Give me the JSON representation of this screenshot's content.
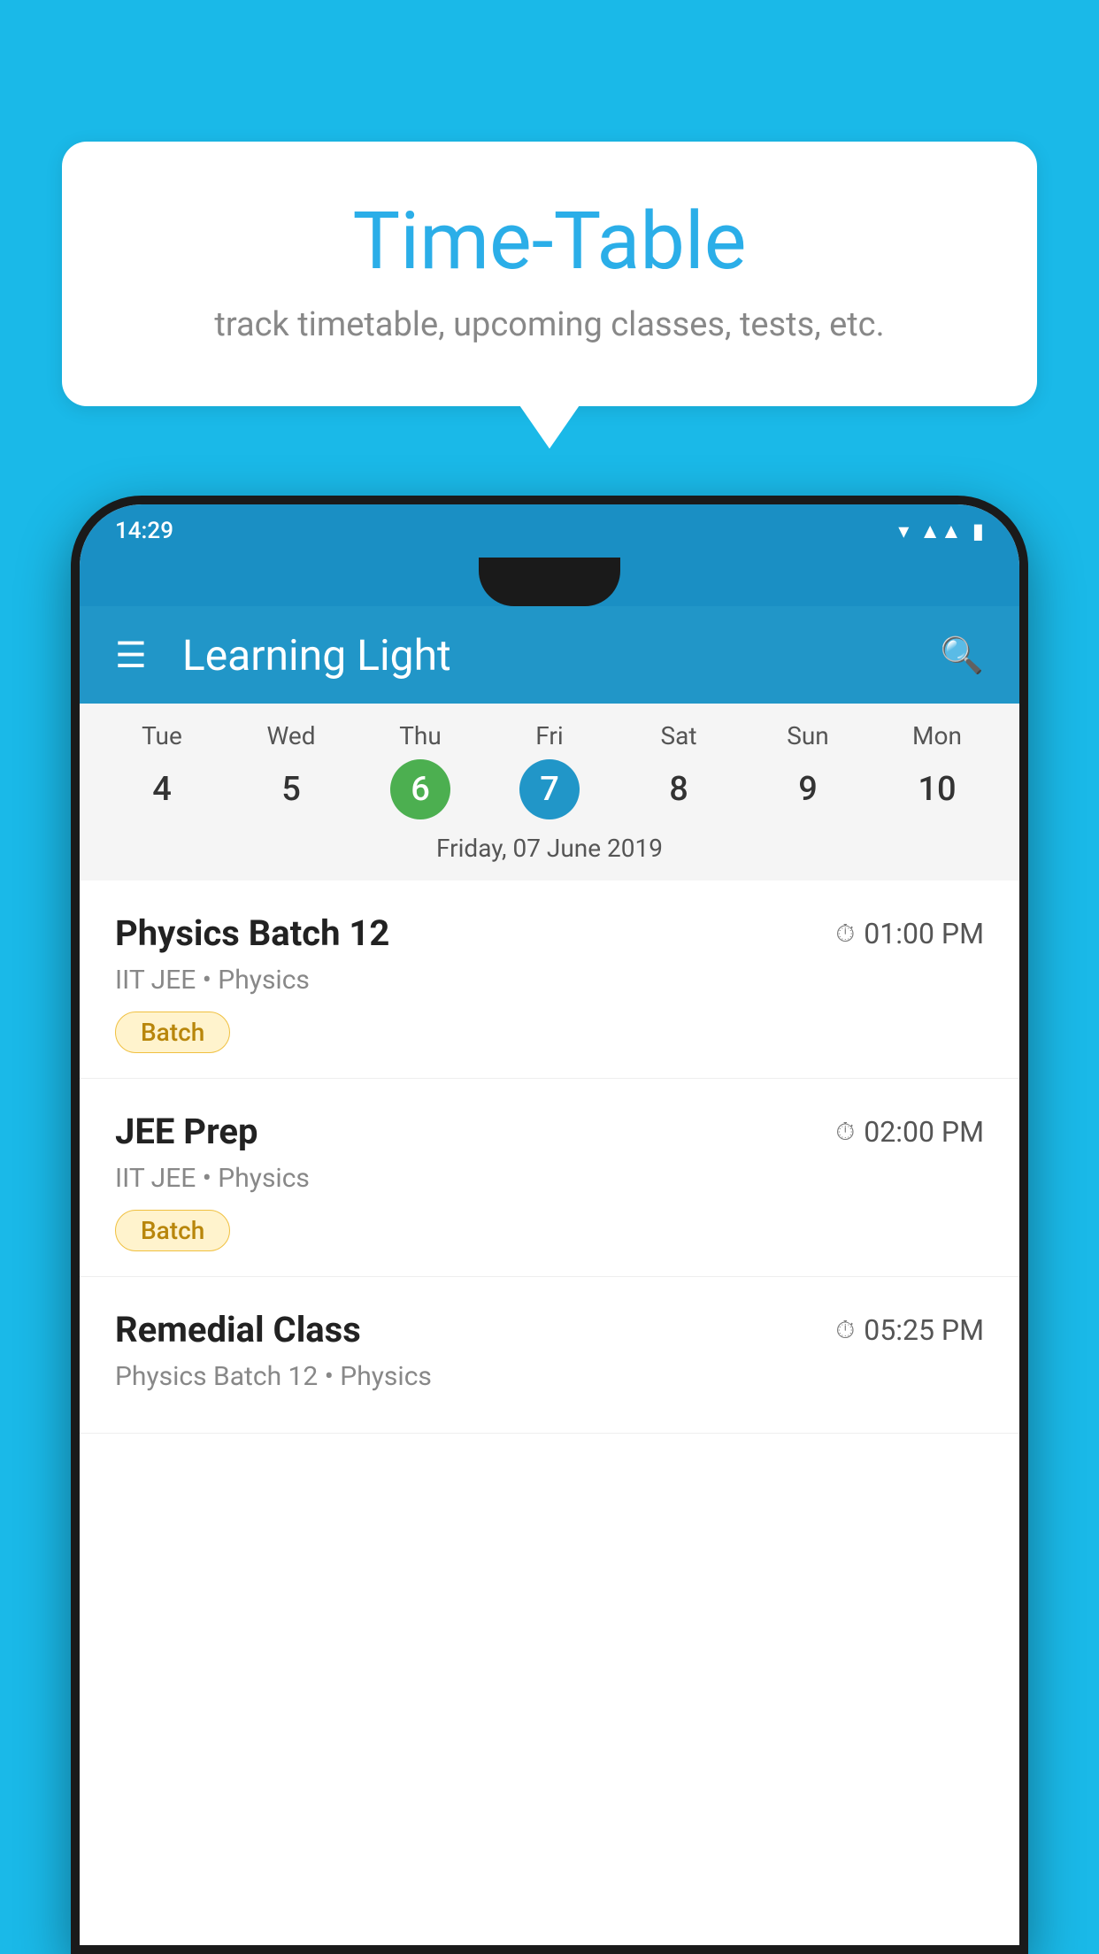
{
  "background_color": "#1ab9e8",
  "bubble": {
    "title": "Time-Table",
    "subtitle": "track timetable, upcoming classes, tests, etc."
  },
  "status_bar": {
    "time": "14:29"
  },
  "app_bar": {
    "title": "Learning Light"
  },
  "calendar": {
    "days": [
      {
        "name": "Tue",
        "number": "4",
        "state": "normal"
      },
      {
        "name": "Wed",
        "number": "5",
        "state": "normal"
      },
      {
        "name": "Thu",
        "number": "6",
        "state": "today"
      },
      {
        "name": "Fri",
        "number": "7",
        "state": "selected"
      },
      {
        "name": "Sat",
        "number": "8",
        "state": "normal"
      },
      {
        "name": "Sun",
        "number": "9",
        "state": "normal"
      },
      {
        "name": "Mon",
        "number": "10",
        "state": "normal"
      }
    ],
    "selected_date_label": "Friday, 07 June 2019"
  },
  "schedule_items": [
    {
      "name": "Physics Batch 12",
      "time": "01:00 PM",
      "meta": "IIT JEE • Physics",
      "badge": "Batch"
    },
    {
      "name": "JEE Prep",
      "time": "02:00 PM",
      "meta": "IIT JEE • Physics",
      "badge": "Batch"
    },
    {
      "name": "Remedial Class",
      "time": "05:25 PM",
      "meta": "Physics Batch 12 • Physics",
      "badge": null
    }
  ]
}
